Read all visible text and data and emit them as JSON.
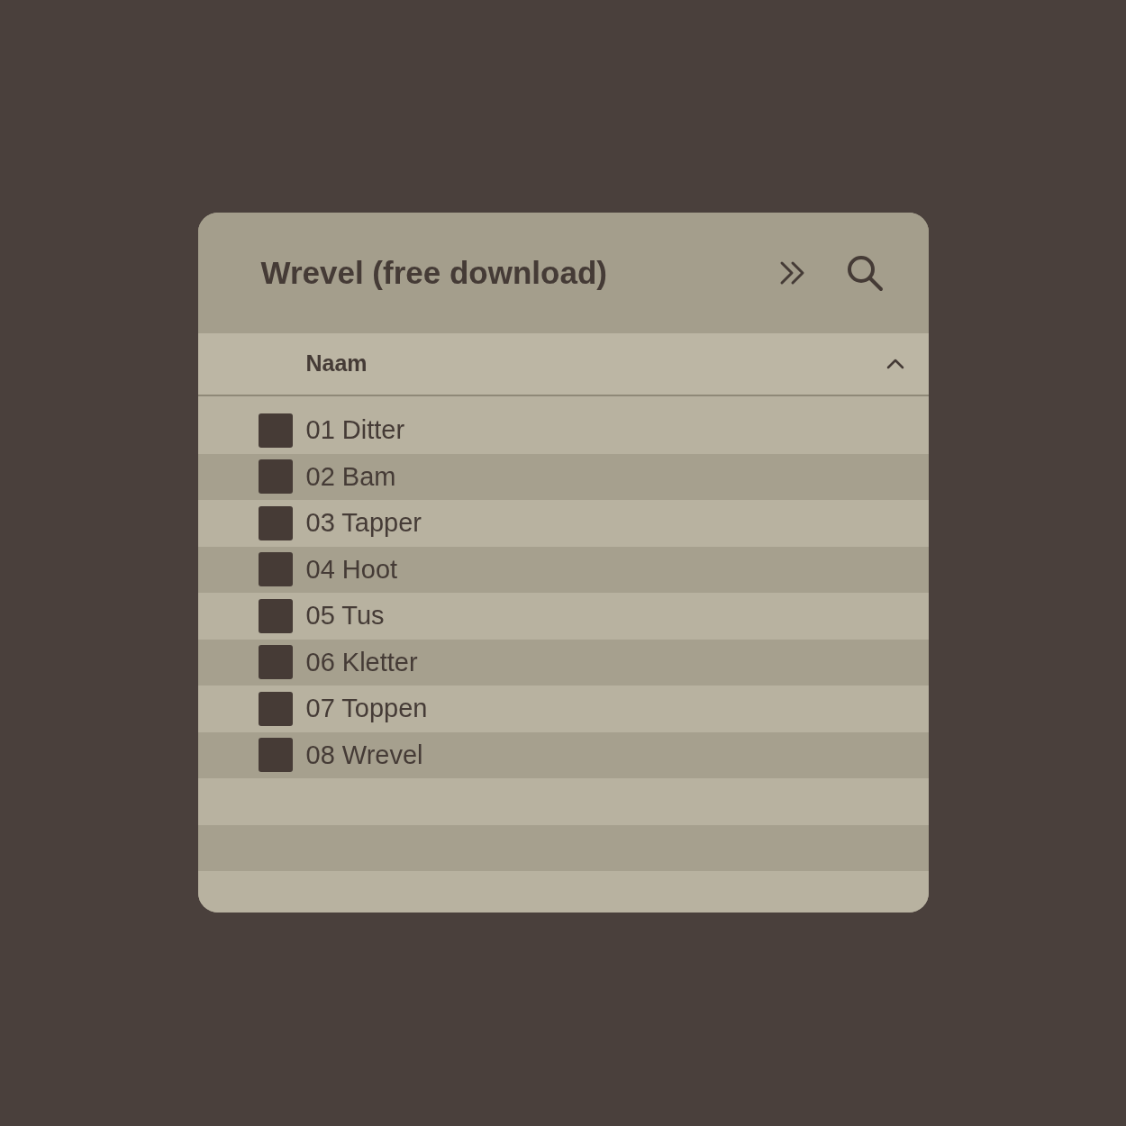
{
  "window": {
    "title": "Wrevel (free download)"
  },
  "table": {
    "columns": [
      {
        "label": "Naam",
        "sort_ascending": true
      }
    ],
    "rows": [
      {
        "name": "01 Ditter"
      },
      {
        "name": "02 Bam"
      },
      {
        "name": "03 Tapper"
      },
      {
        "name": "04 Hoot"
      },
      {
        "name": "05 Tus"
      },
      {
        "name": "06 Kletter"
      },
      {
        "name": "07 Toppen"
      },
      {
        "name": "08 Wrevel"
      }
    ]
  }
}
